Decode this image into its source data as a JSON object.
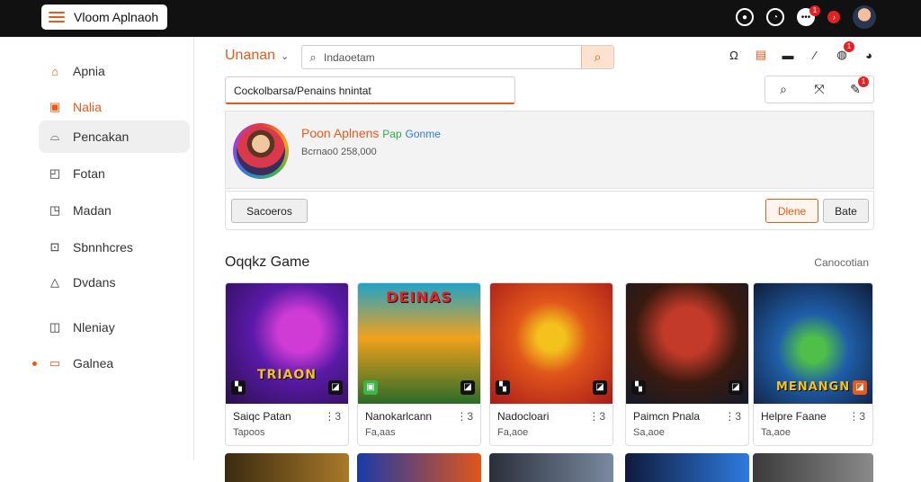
{
  "topbar": {
    "brand": "Vloom Aplnaoh",
    "icons": [
      "clock-outline-icon",
      "clock-icon",
      "chat-icon",
      "music-icon",
      "avatar"
    ],
    "badges": [
      "1",
      "1"
    ]
  },
  "sidebar": {
    "items": [
      {
        "label": "Apnia",
        "icon": "home-icon"
      },
      {
        "label": "Nalia",
        "icon": "square-icon"
      },
      {
        "label": "Pencakan",
        "icon": "hat-icon"
      },
      {
        "label": "Fotan",
        "icon": "box-icon"
      },
      {
        "label": "Madan",
        "icon": "box-arrow-icon"
      },
      {
        "label": "Sbnnhcres",
        "icon": "square-dot-icon"
      },
      {
        "label": "Dvdans",
        "icon": "bell-icon"
      },
      {
        "label": "Nleniay",
        "icon": "folder-icon"
      },
      {
        "label": "Galnea",
        "icon": "slides-icon"
      }
    ]
  },
  "header": {
    "title": "Unanan",
    "search_placeholder": "Indaoetam",
    "icons": [
      "tag-icon",
      "image-icon",
      "layer-icon",
      "pen-icon",
      "globe-icon",
      "avatar"
    ],
    "badge": "1"
  },
  "url": {
    "value": "Cockolbarsa/Penains hnintat"
  },
  "toolbar": {
    "icons": [
      "search-icon",
      "expand-icon",
      "edit-icon"
    ],
    "badge": "1"
  },
  "profile": {
    "name": "Poon Aplnens",
    "tag_green": "Pap",
    "tag_blue": "Gonme",
    "sub": "Bcrnao0 258,000"
  },
  "actions": {
    "left": "Sacoeros",
    "orange": "Dlene",
    "gray": "Bate"
  },
  "section": {
    "title": "Oqqkz Game",
    "link": "Canocotian"
  },
  "cards": [
    {
      "title": "Saiqc Patan",
      "sub": "Tapoos",
      "more": "⋮3",
      "art": "TRIAON",
      "colors": [
        "#5a1aa8",
        "#d03bd6",
        "#2a0f4d"
      ]
    },
    {
      "title": "Nanokarlcann",
      "sub": "Fa,aas",
      "more": "⋮3",
      "art": "DEINAS",
      "colors": [
        "#1fa3c9",
        "#f0a21c",
        "#2b6b28"
      ]
    },
    {
      "title": "Nadocloari",
      "sub": "Fa,aoe",
      "more": "⋮3",
      "art": "",
      "colors": [
        "#e0561a",
        "#f3c21c",
        "#a81a1a"
      ]
    },
    {
      "title": "Paimcn Pnala",
      "sub": "Sa,aoe",
      "more": "⋮3",
      "art": "",
      "colors": [
        "#3a1a0f",
        "#c33a2a",
        "#131a2a"
      ]
    },
    {
      "title": "Helpre Faane",
      "sub": "Ta,aoe",
      "more": "⋮3",
      "art": "MENANGN",
      "colors": [
        "#1f5ea8",
        "#4fbf4a",
        "#0f1d3a"
      ]
    }
  ]
}
